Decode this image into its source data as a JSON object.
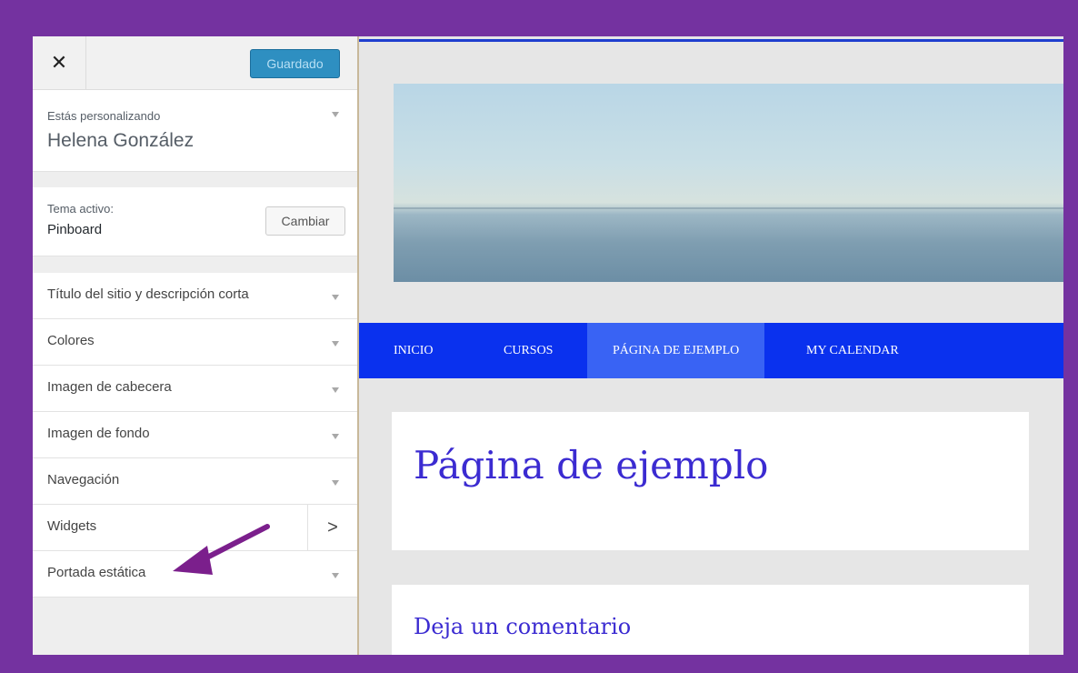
{
  "topbar": {
    "close_symbol": "✕",
    "save_label": "Guardado"
  },
  "info": {
    "label": "Estás personalizando",
    "site_name": "Helena González"
  },
  "theme": {
    "label": "Tema activo:",
    "name": "Pinboard",
    "change_label": "Cambiar"
  },
  "sections": [
    {
      "label": "Título del sitio y descripción corta",
      "icon": "triangle-down-icon"
    },
    {
      "label": "Colores",
      "icon": "triangle-down-icon"
    },
    {
      "label": "Imagen de cabecera",
      "icon": "triangle-down-icon"
    },
    {
      "label": "Imagen de fondo",
      "icon": "triangle-down-icon"
    },
    {
      "label": "Navegación",
      "icon": "triangle-down-icon"
    },
    {
      "label": "Widgets",
      "icon": "chevron-right-icon",
      "chevron": ">"
    },
    {
      "label": "Portada estática",
      "icon": "triangle-down-icon"
    }
  ],
  "preview": {
    "nav": [
      {
        "label": "INICIO"
      },
      {
        "label": "CURSOS"
      },
      {
        "label": "PÁGINA DE EJEMPLO",
        "active": true
      },
      {
        "label": "MY CALENDAR"
      }
    ],
    "page_title": "Página de ejemplo",
    "comment_title": "Deja un comentario"
  },
  "colors": {
    "frame_border": "#7432a0",
    "save_button": "#2e8fc1",
    "nav_background": "#0a31ee",
    "nav_active": "#3963f4",
    "title_text": "#3b2bd1",
    "annotation_arrow": "#7b1f8c"
  }
}
